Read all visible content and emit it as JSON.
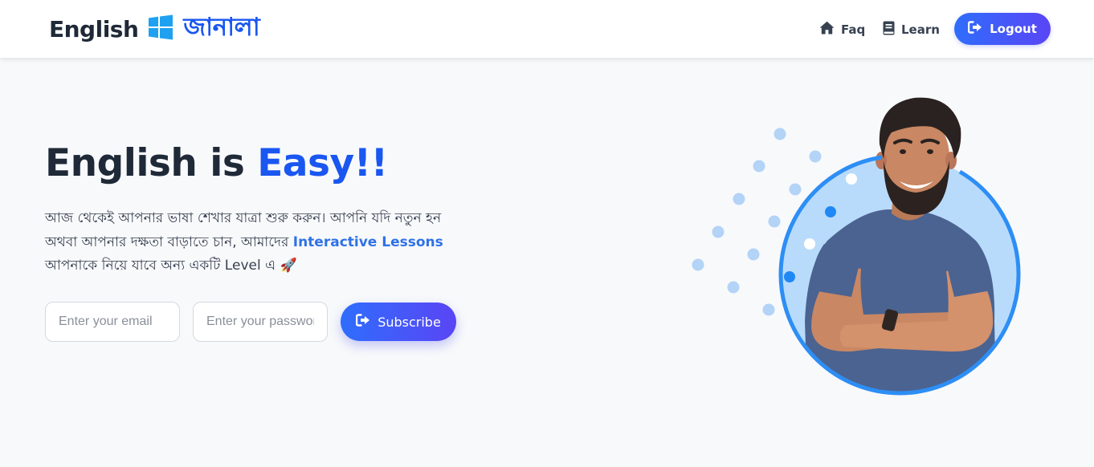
{
  "nav": {
    "brand_english": "English",
    "brand_bangla": "জানালা",
    "links": [
      {
        "label": "Faq",
        "icon": "home-icon"
      },
      {
        "label": "Learn",
        "icon": "book-icon"
      }
    ],
    "logout_label": "Logout"
  },
  "hero": {
    "title_part1": "English is",
    "title_accent": "Easy!!",
    "desc_part1": "আজ থেকেই আপনার ভাষা শেখার যাত্রা শুরু করুন। আপনি যদি নতুন হন অথবা আপনার দক্ষতা বাড়াতে চান, আমাদের",
    "desc_highlight": "Interactive Lessons",
    "desc_part2": "আপনাকে নিয়ে যাবে অন্য একটি Level এ",
    "desc_emoji": "🚀"
  },
  "form": {
    "email_placeholder": "Enter your email",
    "password_placeholder": "Enter your password",
    "subscribe_label": "Subscribe"
  },
  "colors": {
    "accent": "#1a56f0",
    "button_gradient_start": "#2f6dfc",
    "button_gradient_end": "#5a45f5",
    "circle_border": "#2d8ef5",
    "circle_fill": "#b9dbfb"
  }
}
